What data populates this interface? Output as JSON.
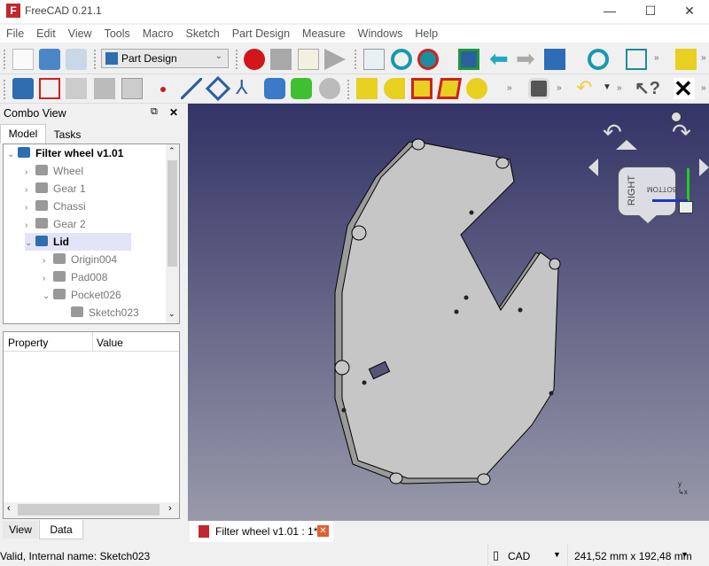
{
  "window": {
    "title": "FreeCAD 0.21.1",
    "minimize": "—",
    "maximize": "☐",
    "close": "✕"
  },
  "menu": [
    "File",
    "Edit",
    "View",
    "Tools",
    "Macro",
    "Sketch",
    "Part Design",
    "Measure",
    "Windows",
    "Help"
  ],
  "toolbar": {
    "workbench": "Part Design",
    "more": "»"
  },
  "combo": {
    "title": "Combo View",
    "tabs": [
      "Model",
      "Tasks"
    ],
    "bottom_tabs": [
      "View",
      "Data"
    ],
    "tree": [
      {
        "label": "Filter wheel v1.01",
        "level": 0,
        "arrow": "⌄",
        "bold": true,
        "dim": false
      },
      {
        "label": "Wheel",
        "level": 1,
        "arrow": "›",
        "dim": true
      },
      {
        "label": "Gear 1",
        "level": 1,
        "arrow": "›",
        "dim": true
      },
      {
        "label": "Chassi",
        "level": 1,
        "arrow": "›",
        "dim": true
      },
      {
        "label": "Gear 2",
        "level": 1,
        "arrow": "›",
        "dim": true
      },
      {
        "label": "Lid",
        "level": 1,
        "arrow": "⌄",
        "bold": true,
        "selected": true
      },
      {
        "label": "Origin004",
        "level": 2,
        "arrow": "›",
        "dim": true
      },
      {
        "label": "Pad008",
        "level": 2,
        "arrow": "›",
        "dim": true
      },
      {
        "label": "Pocket026",
        "level": 2,
        "arrow": "⌄",
        "dim": true
      },
      {
        "label": "Sketch023",
        "level": 3,
        "arrow": "",
        "dim": true
      }
    ],
    "property_headers": [
      "Property",
      "Value"
    ]
  },
  "navcube": {
    "faces": [
      "RIGHT",
      "BOTTOM"
    ]
  },
  "doc_tab": "Filter wheel v1.01 : 1*",
  "status": {
    "message": "Valid, Internal name: Sketch023",
    "nav_style": "CAD",
    "dimensions": "241,52 mm x 192,48 mm"
  },
  "colors": {
    "accent": "#3a6ea5",
    "viewport_top": "#333366",
    "viewport_bottom": "#9999aa"
  }
}
